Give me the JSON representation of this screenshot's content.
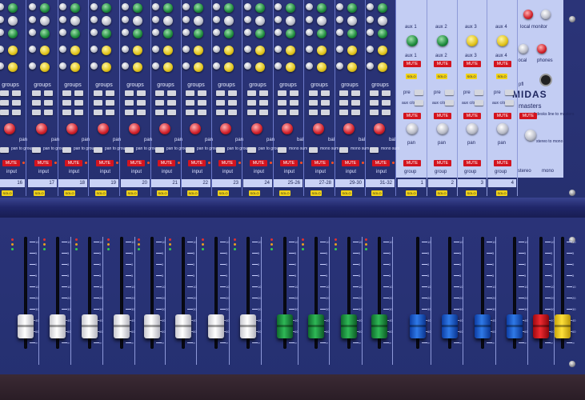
{
  "brand": "MIDAS",
  "masters_label": "masters",
  "input_strips": {
    "section_labels": [
      "groups",
      "groups",
      "groups",
      "groups",
      "groups",
      "groups",
      "groups",
      "groups",
      "groups",
      "groups",
      "groups",
      "groups",
      "groups"
    ],
    "pan_label": "pan",
    "bal_label": "bal",
    "pan_to_groups": "pan to groups",
    "mono_sum": "mono sum",
    "mute": "MUTE",
    "solo": "SOLO",
    "input": "input",
    "channel_numbers": [
      "16",
      "17",
      "18",
      "19",
      "20",
      "21",
      "22",
      "23",
      "24",
      "25-26",
      "27-28",
      "29-30",
      "31-32"
    ]
  },
  "group_strips": {
    "aux_labels": [
      "aux 1",
      "aux 2",
      "aux 3",
      "aux 4"
    ],
    "local_monitor": "local monitor",
    "local": "local",
    "phones": "phones",
    "pfl": "pfl",
    "aux_cfl": "aux c/o",
    "group_label": "group",
    "group_numbers": [
      "1",
      "2",
      "3",
      "4"
    ],
    "pre": "pre",
    "stereo_label": "stereo",
    "mono_label": "mono",
    "stereo_to_mono": "stereo to mono",
    "all_desks_line_to_masters": "all desks line to masters"
  },
  "faders": {
    "scale_values": [
      "10",
      "5",
      "0",
      "5",
      "10",
      "20",
      "30",
      "40",
      "60",
      "∞"
    ],
    "cap_colors": [
      "white",
      "white",
      "white",
      "white",
      "white",
      "white",
      "white",
      "white",
      "green",
      "green",
      "green",
      "green",
      "blue",
      "blue",
      "blue",
      "blue",
      "red",
      "yellow"
    ],
    "levels_fraction_from_bottom": [
      0.2,
      0.2,
      0.2,
      0.2,
      0.2,
      0.2,
      0.2,
      0.2,
      0.2,
      0.2,
      0.2,
      0.2,
      0.2,
      0.2,
      0.2,
      0.2,
      0.2,
      0.2
    ]
  },
  "colors": {
    "panel": "#263070",
    "master_panel": "#c3cdf3",
    "mute_red": "#d3141f",
    "solo_yellow": "#f0d21a"
  }
}
